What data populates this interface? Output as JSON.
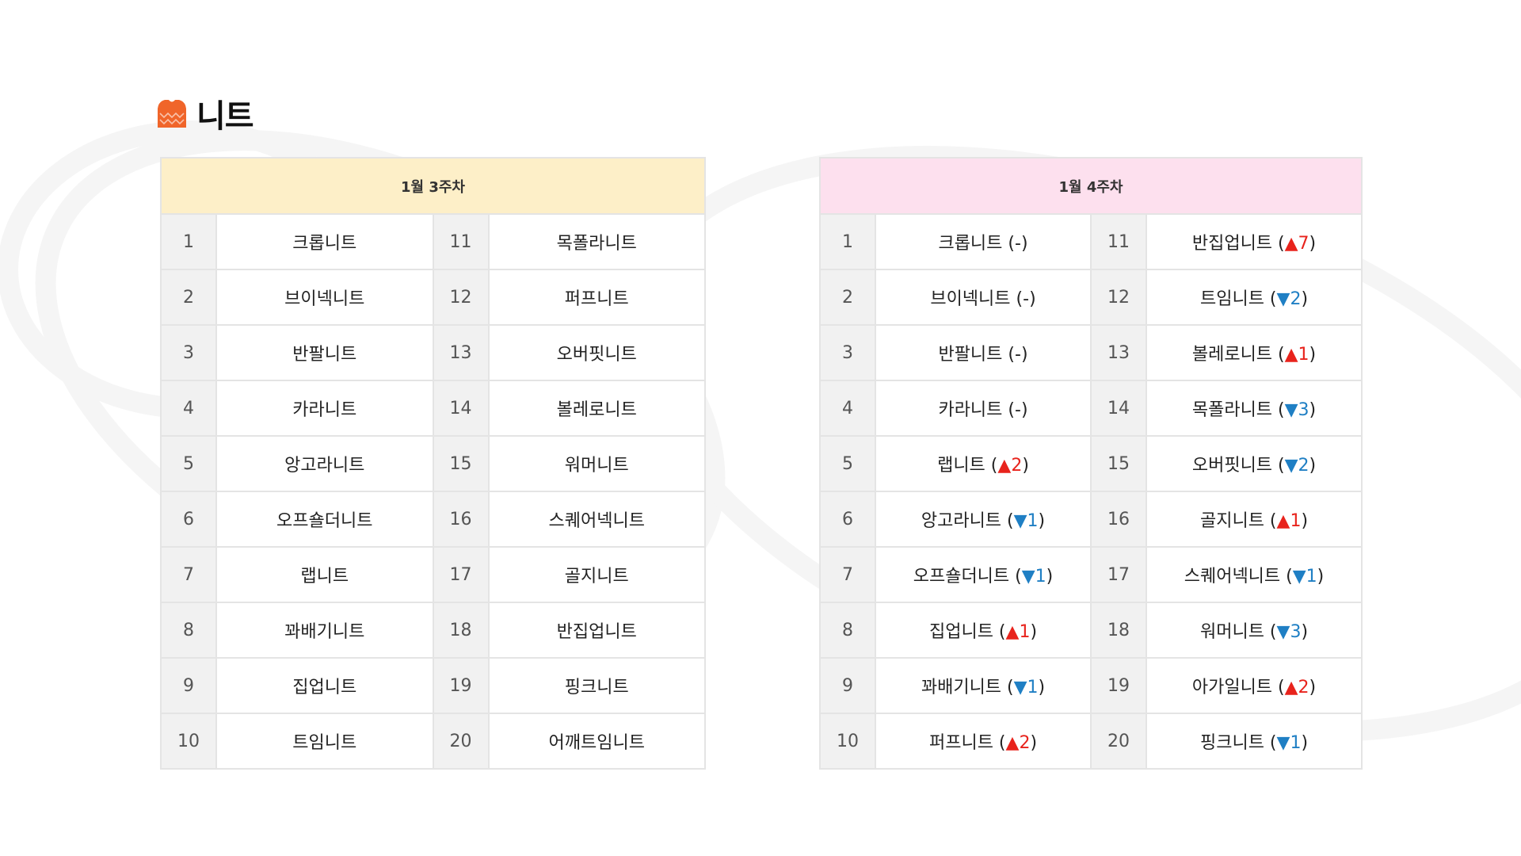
{
  "page": {
    "title": "니트",
    "icon": "sweater-icon"
  },
  "colors": {
    "accent_orange": "#f0652a",
    "week3_header_bg": "#fdefc8",
    "week4_header_bg": "#fde0ee",
    "rank_cell_bg": "#f1f1f1",
    "up_color": "#e8231c",
    "down_color": "#1f7fc4"
  },
  "week3": {
    "header": "1월 3주차",
    "rows": [
      {
        "left_rank": "1",
        "left_item": "크롭니트",
        "right_rank": "11",
        "right_item": "목폴라니트"
      },
      {
        "left_rank": "2",
        "left_item": "브이넥니트",
        "right_rank": "12",
        "right_item": "퍼프니트"
      },
      {
        "left_rank": "3",
        "left_item": "반팔니트",
        "right_rank": "13",
        "right_item": "오버핏니트"
      },
      {
        "left_rank": "4",
        "left_item": "카라니트",
        "right_rank": "14",
        "right_item": "볼레로니트"
      },
      {
        "left_rank": "5",
        "left_item": "앙고라니트",
        "right_rank": "15",
        "right_item": "워머니트"
      },
      {
        "left_rank": "6",
        "left_item": "오프숄더니트",
        "right_rank": "16",
        "right_item": "스퀘어넥니트"
      },
      {
        "left_rank": "7",
        "left_item": "랩니트",
        "right_rank": "17",
        "right_item": "골지니트"
      },
      {
        "left_rank": "8",
        "left_item": "꽈배기니트",
        "right_rank": "18",
        "right_item": "반집업니트"
      },
      {
        "left_rank": "9",
        "left_item": "집업니트",
        "right_rank": "19",
        "right_item": "핑크니트"
      },
      {
        "left_rank": "10",
        "left_item": "트임니트",
        "right_rank": "20",
        "right_item": "어깨트임니트"
      }
    ]
  },
  "week4": {
    "header": "1월 4주차",
    "rows": [
      {
        "left_rank": "1",
        "left_name": "크롭니트",
        "left_change": "-",
        "left_dir": "none",
        "right_rank": "11",
        "right_name": "반집업니트",
        "right_change": "7",
        "right_dir": "up"
      },
      {
        "left_rank": "2",
        "left_name": "브이넥니트",
        "left_change": "-",
        "left_dir": "none",
        "right_rank": "12",
        "right_name": "트임니트",
        "right_change": "2",
        "right_dir": "down"
      },
      {
        "left_rank": "3",
        "left_name": "반팔니트",
        "left_change": "-",
        "left_dir": "none",
        "right_rank": "13",
        "right_name": "볼레로니트",
        "right_change": "1",
        "right_dir": "up"
      },
      {
        "left_rank": "4",
        "left_name": "카라니트",
        "left_change": "-",
        "left_dir": "none",
        "right_rank": "14",
        "right_name": "목폴라니트",
        "right_change": "3",
        "right_dir": "down"
      },
      {
        "left_rank": "5",
        "left_name": "랩니트",
        "left_change": "2",
        "left_dir": "up",
        "right_rank": "15",
        "right_name": "오버핏니트",
        "right_change": "2",
        "right_dir": "down"
      },
      {
        "left_rank": "6",
        "left_name": "앙고라니트",
        "left_change": "1",
        "left_dir": "down",
        "right_rank": "16",
        "right_name": "골지니트",
        "right_change": "1",
        "right_dir": "up"
      },
      {
        "left_rank": "7",
        "left_name": "오프숄더니트",
        "left_change": "1",
        "left_dir": "down",
        "right_rank": "17",
        "right_name": "스퀘어넥니트",
        "right_change": "1",
        "right_dir": "down"
      },
      {
        "left_rank": "8",
        "left_name": "집업니트",
        "left_change": "1",
        "left_dir": "up",
        "right_rank": "18",
        "right_name": "워머니트",
        "right_change": "3",
        "right_dir": "down"
      },
      {
        "left_rank": "9",
        "left_name": "꽈배기니트",
        "left_change": "1",
        "left_dir": "down",
        "right_rank": "19",
        "right_name": "아가일니트",
        "right_change": "2",
        "right_dir": "up"
      },
      {
        "left_rank": "10",
        "left_name": "퍼프니트",
        "left_change": "2",
        "left_dir": "up",
        "right_rank": "20",
        "right_name": "핑크니트",
        "right_change": "1",
        "right_dir": "down"
      }
    ]
  }
}
